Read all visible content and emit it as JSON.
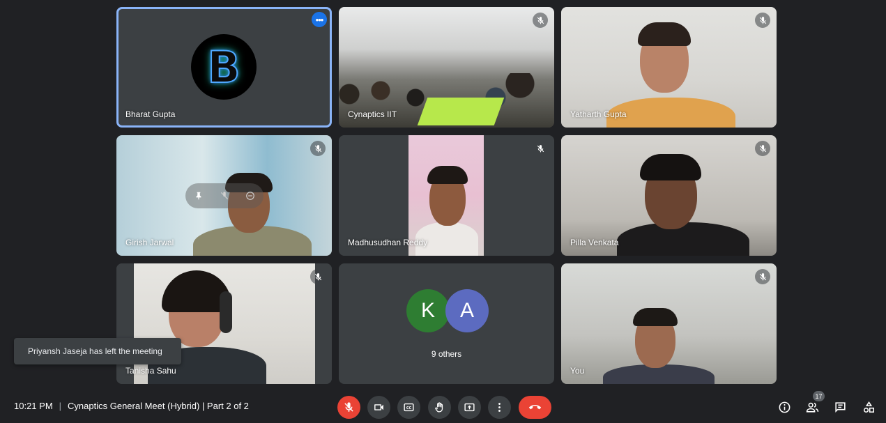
{
  "participants": [
    {
      "name": "Bharat Gupta",
      "avatar_letter": "B",
      "muted": false,
      "speaking": true
    },
    {
      "name": "Cynaptics IIT",
      "muted": true
    },
    {
      "name": "Yatharth Gupta",
      "muted": true
    },
    {
      "name": "Girish Jarwal",
      "muted": true
    },
    {
      "name": "Madhusudhan Reddy",
      "muted": true
    },
    {
      "name": "Pilla Venkata",
      "muted": true
    },
    {
      "name": "Tanisha Sahu",
      "muted": true
    },
    {
      "name": "You",
      "muted": true
    }
  ],
  "others_tile": {
    "avatars": [
      {
        "letter": "K",
        "color": "#2e7d32"
      },
      {
        "letter": "A",
        "color": "#5c6bc0"
      }
    ],
    "label": "9 others"
  },
  "toast": {
    "text": "Priyansh Jaseja has left the meeting"
  },
  "meeting": {
    "time": "10:21 PM",
    "separator": "|",
    "title": "Cynaptics General Meet (Hybrid) | Part 2 of 2"
  },
  "controls": {
    "mic": "mic-off-icon",
    "camera": "camera-icon",
    "captions": "captions-icon",
    "raise_hand": "hand-icon",
    "present": "present-icon",
    "more": "more-vert-icon",
    "leave": "end-call-icon"
  },
  "side_controls": {
    "participant_count": "17"
  },
  "colors": {
    "background": "#202124",
    "tile": "#3c4043",
    "active_border": "#8ab4f8",
    "danger": "#ea4335"
  }
}
